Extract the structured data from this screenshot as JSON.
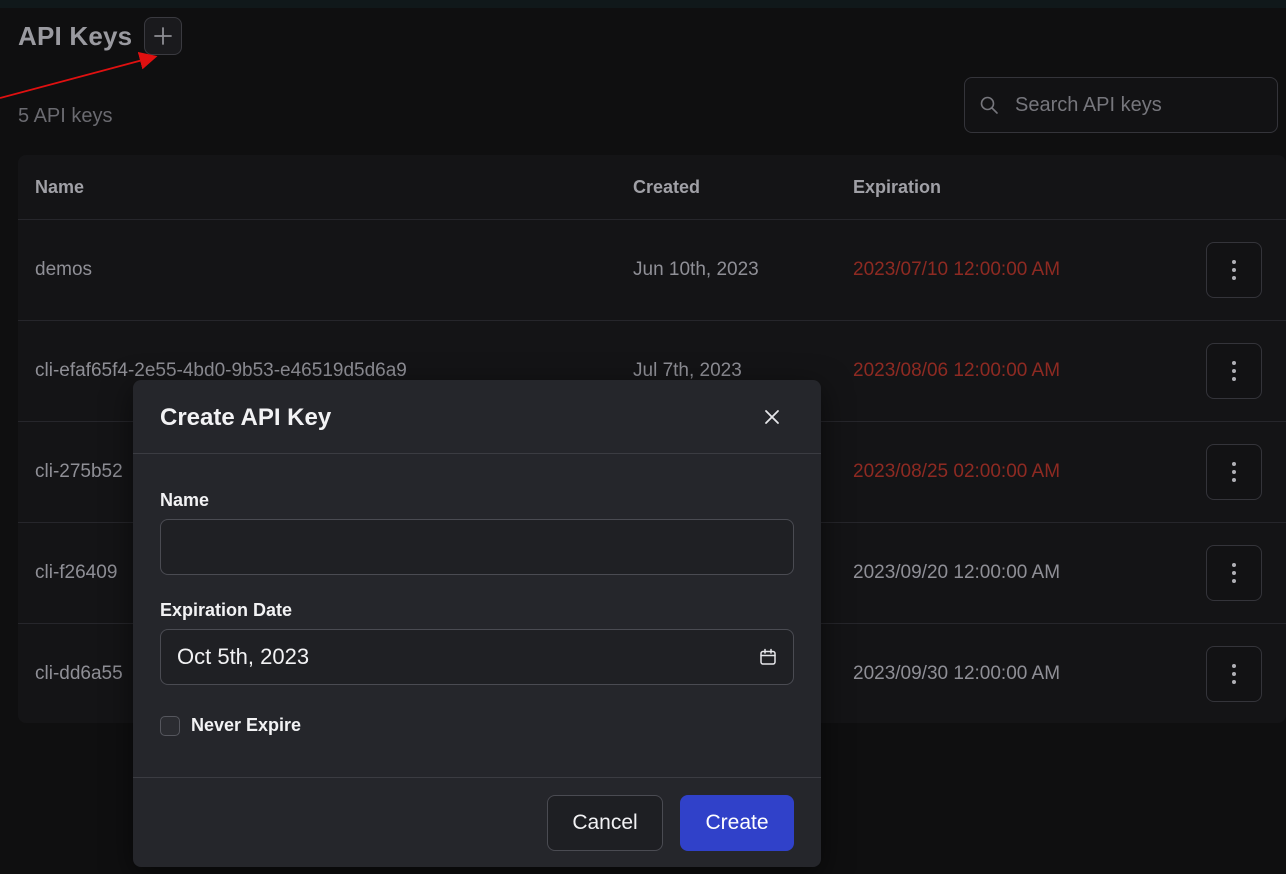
{
  "header": {
    "title": "API Keys",
    "add_icon": "plus-icon"
  },
  "summary": {
    "count_text": "5 API keys"
  },
  "search": {
    "placeholder": "Search API keys",
    "icon": "search-icon"
  },
  "table": {
    "columns": [
      "Name",
      "Created",
      "Expiration"
    ],
    "rows": [
      {
        "name": "demos",
        "created": "Jun 10th, 2023",
        "expiration": "2023/07/10 12:00:00 AM",
        "expired": true
      },
      {
        "name": "cli-efaf65f4-2e55-4bd0-9b53-e46519d5d6a9",
        "created": "Jul 7th, 2023",
        "expiration": "2023/08/06 12:00:00 AM",
        "expired": true
      },
      {
        "name": "cli-275b52",
        "created": "",
        "expiration": "2023/08/25 02:00:00 AM",
        "expired": true
      },
      {
        "name": "cli-f26409",
        "created": "",
        "expiration": "2023/09/20 12:00:00 AM",
        "expired": false
      },
      {
        "name": "cli-dd6a55",
        "created": "",
        "expiration": "2023/09/30 12:00:00 AM",
        "expired": false
      }
    ],
    "row_menu_icon": "more-vertical-icon"
  },
  "modal": {
    "title": "Create API Key",
    "close_icon": "close-icon",
    "name_label": "Name",
    "name_value": "",
    "expiration_label": "Expiration Date",
    "expiration_value": "Oct 5th, 2023",
    "calendar_icon": "calendar-icon",
    "never_expire_label": "Never Expire",
    "never_expire_checked": false,
    "cancel_label": "Cancel",
    "create_label": "Create"
  },
  "colors": {
    "accent": "#3041c9",
    "expired": "#8e2a22",
    "annotation_arrow": "#e01010"
  }
}
